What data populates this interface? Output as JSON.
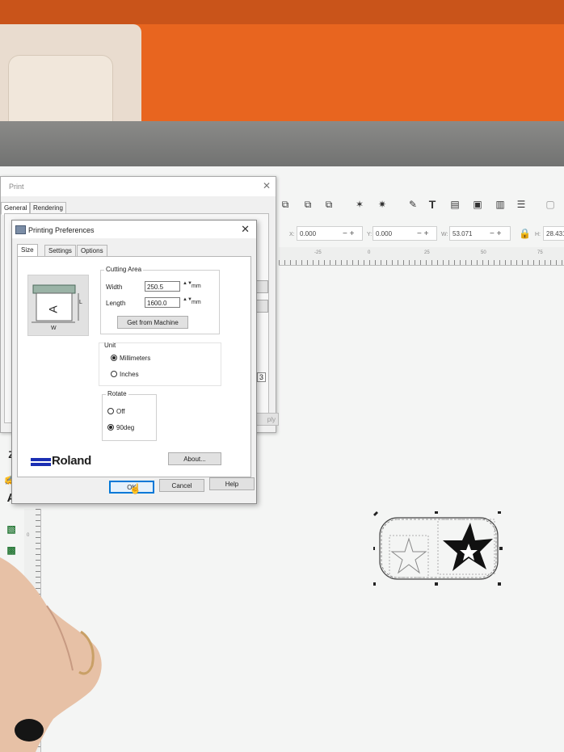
{
  "print_dialog": {
    "title": "Print",
    "tabs": [
      "General",
      "Rendering"
    ],
    "apply_label": "ply",
    "side_text": "3"
  },
  "toolbar": {
    "x_label": "X:",
    "x_value": "0.000",
    "y_label": "Y:",
    "y_value": "0.000",
    "w_label": "W:",
    "w_value": "53.071",
    "h_label": "H:",
    "h_value": "28.431",
    "pm": "− +",
    "icons": [
      "align-icon",
      "group-icon",
      "ungroup-icon",
      "node-icon",
      "transform-icon",
      "edit-icon",
      "text-tool-icon",
      "layers-icon",
      "export-icon",
      "panel-icon",
      "preferences-icon",
      "zoom-icon"
    ],
    "text_tool_glyph": "T"
  },
  "ruler": {
    "top_labels": [
      "-25",
      "0",
      "25",
      "50",
      "75"
    ],
    "left_labels": [
      "0"
    ]
  },
  "left_tools": [
    "Z",
    "A"
  ],
  "printing_preferences": {
    "title": "Printing Preferences",
    "tabs": [
      "Size",
      "Settings",
      "Options"
    ],
    "active_tab": "Size",
    "graphic": {
      "letter": "A",
      "length_letter": "L",
      "width_letter": "W"
    },
    "cutting_area": {
      "label": "Cutting Area",
      "width_label": "Width",
      "width_value": "250.5",
      "length_label": "Length",
      "length_value": "1600.0",
      "unit_mm": "mm",
      "spin": "▲▼",
      "get_from_machine": "Get from Machine"
    },
    "unit": {
      "label": "Unit",
      "options": [
        "Millimeters",
        "Inches"
      ],
      "selected": "Millimeters"
    },
    "rotate": {
      "label": "Rotate",
      "options": [
        "Off",
        "90deg"
      ],
      "selected": "90deg"
    },
    "brand": "Roland",
    "about_label": "About...",
    "ok_label": "OK",
    "cancel_label": "Cancel",
    "help_label": "Help"
  }
}
